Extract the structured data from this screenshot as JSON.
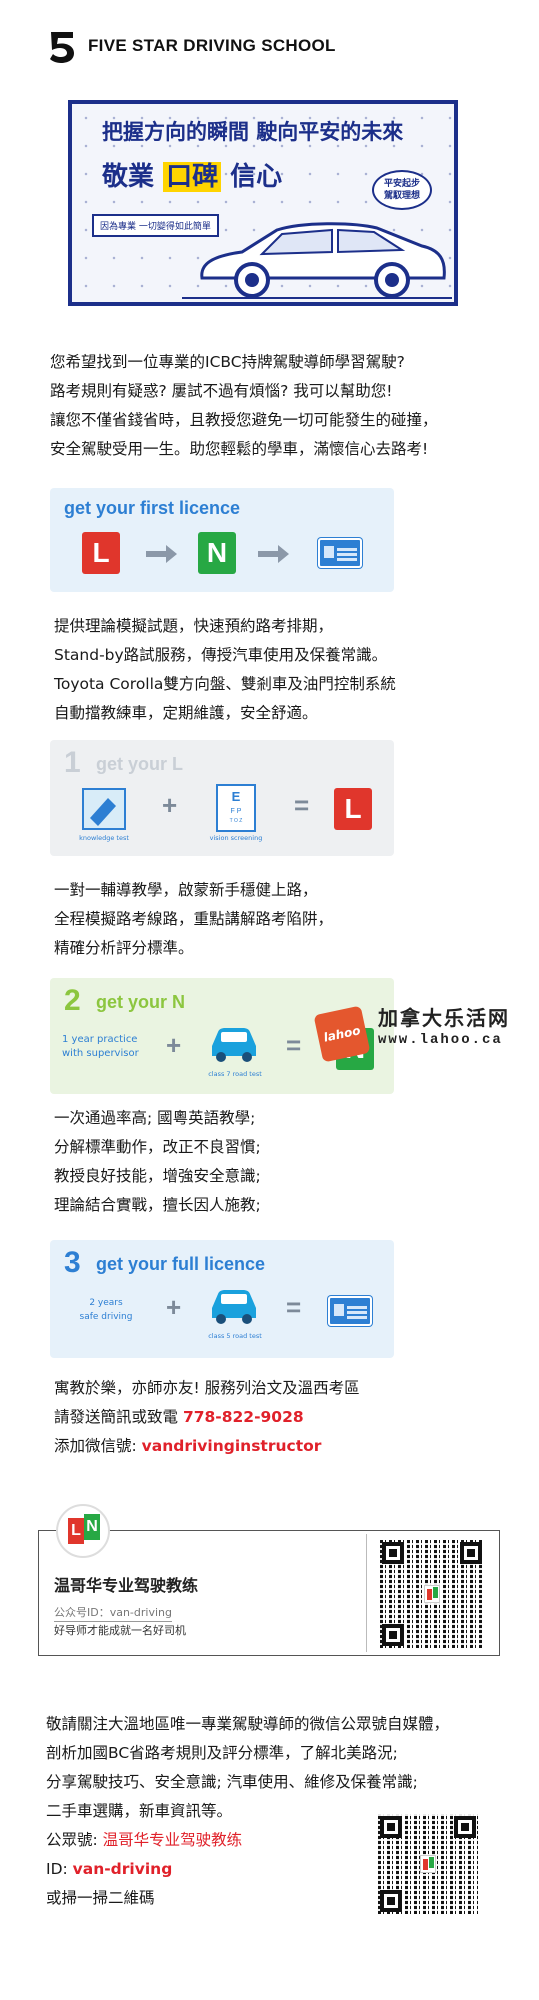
{
  "header": {
    "brand": "FIVE STAR DRIVING SCHOOL",
    "logo_icon": "five-star-5-logo"
  },
  "banner": {
    "slogan_line1": "把握方向的瞬間 駛向平安的未來",
    "slogan_line2_a": "敬業",
    "slogan_line2_b": "口碑",
    "slogan_line2_c": "信心",
    "badge": "平安起步\n駕馭理想",
    "tag": "因為專業 一切變得如此簡單",
    "accent": "#1c2f8a",
    "highlight": "#ffd400"
  },
  "intro": [
    "您希望找到一位專業的ICBC持牌駕駛導師學習駕駛?",
    "路考規則有疑惑? 屢試不過有煩惱?  我可以幫助您!",
    "讓您不僅省錢省時，且教授您避免一切可能發生的碰撞，",
    "安全駕駛受用一生。助您輕鬆的學車，滿懷信心去路考!"
  ],
  "card_first": {
    "title": "get your first licence",
    "l": "L",
    "n": "N"
  },
  "services": [
    "提供理論模擬試題，快速預約路考排期，",
    "Stand-by路試服務，傳授汽車使用及保養常識。",
    "Toyota Corolla雙方向盤、雙剎車及油門控制系統",
    "自動擋教練車，定期維護，安全舒適。"
  ],
  "card_l": {
    "num": "1",
    "title": "get your L",
    "cap1": "knowledge test",
    "cap2": "vision screening",
    "plate": "L"
  },
  "one_on_one": [
    "一對一輔導教學，啟蒙新手穩健上路，",
    "全程模擬路考線路，重點講解路考陷阱，",
    "精確分析評分標準。"
  ],
  "card_n": {
    "num": "2",
    "title": "get your N",
    "text1": "1 year practice",
    "text2": "with supervisor",
    "cap": "class 7 road test",
    "plate": "N"
  },
  "watermark": {
    "logo": "lahoo",
    "cn": "加拿大乐活网",
    "url": "www.lahoo.ca"
  },
  "pass_rate": [
    "一次通過率高; 國粵英語教學;",
    "分解標準動作，改正不良習慣;",
    "教授良好技能，增強安全意識;",
    "理論結合實戰，擅长因人施教;"
  ],
  "card_full": {
    "num": "3",
    "title": "get your full licence",
    "text1": "2 years",
    "text2": "safe driving",
    "cap": "class 5 road test"
  },
  "contact": {
    "line1": "寓教於樂，亦師亦友! 服務列治文及溫西考區",
    "line2_label": "請發送簡訊或致電 ",
    "phone": "778-822-9028",
    "line3_label": "添加微信號: ",
    "wechat": "vandrivinginstructor"
  },
  "profile": {
    "name": "温哥华专业驾驶教练",
    "id": "公众号ID：van-driving",
    "motto": "好导师才能成就一名好司机"
  },
  "follow": {
    "lines": [
      "敬請關注大溫地區唯一專業駕駛導師的微信公眾號自媒體，",
      "剖析加國BC省路考規則及評分標準，了解北美路況;",
      "分享駕駛技巧、安全意識; 汽車使用、維修及保養常識;",
      "二手車選購，新車資訊等。"
    ],
    "account_label": "公眾號: ",
    "account": "温哥华专业驾驶教练",
    "id_label": "ID: ",
    "id": "van-driving",
    "scan": "或掃一掃二維碼"
  }
}
